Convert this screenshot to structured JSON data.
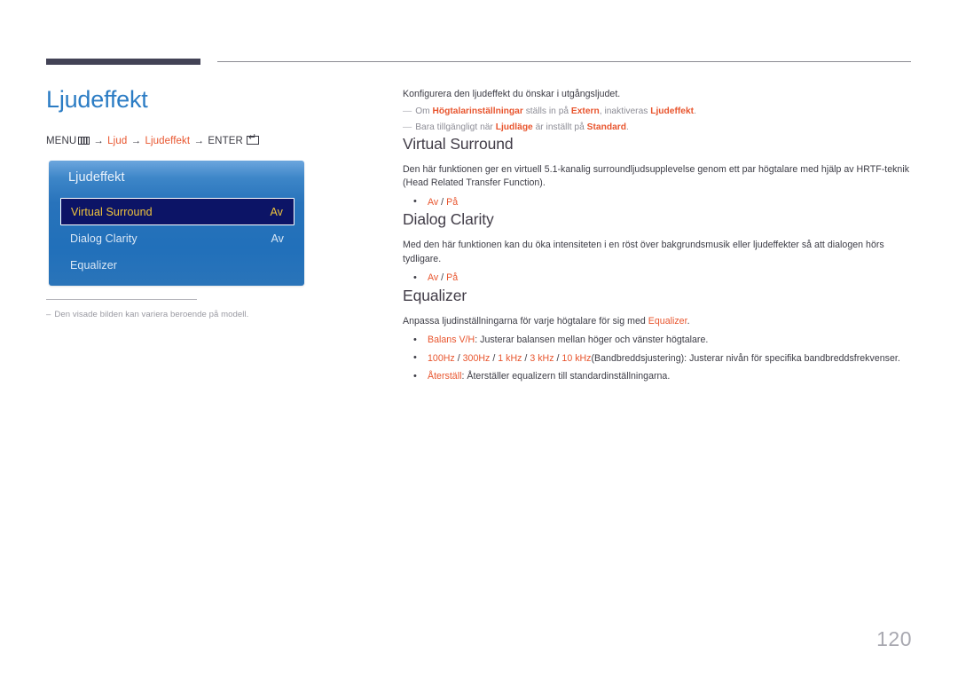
{
  "page": {
    "title": "Ljudeffekt",
    "number": "120"
  },
  "menu_path": {
    "prefix": "MENU",
    "menu_icon": "menu-grid-icon",
    "arrow": "→",
    "step1": "Ljud",
    "step2": "Ljudeffekt",
    "enter": "ENTER",
    "enter_icon": "enter-return-icon"
  },
  "osd": {
    "title": "Ljudeffekt",
    "rows": [
      {
        "label": "Virtual Surround",
        "value": "Av",
        "selected": true
      },
      {
        "label": "Dialog Clarity",
        "value": "Av",
        "selected": false
      },
      {
        "label": "Equalizer",
        "value": "",
        "selected": false
      }
    ]
  },
  "left_footnote": {
    "dash": "–",
    "text": "Den visade bilden kan variera beroende på modell."
  },
  "intro": {
    "paragraph": "Konfigurera den ljudeffekt du önskar i utgångsljudet.",
    "notes": [
      {
        "dash": "—",
        "p1": "Om ",
        "a1": "Högtalarinställningar",
        "p2": " ställs in på ",
        "a2": "Extern",
        "p3": ", inaktiveras ",
        "a3": "Ljudeffekt",
        "p4": "."
      },
      {
        "dash": "—",
        "p1": "Bara tillgängligt när ",
        "a1": "Ljudläge",
        "p2": " är inställt på ",
        "a2": "Standard",
        "p3": ".",
        "a3": "",
        "p4": ""
      }
    ]
  },
  "sections": [
    {
      "heading": "Virtual Surround",
      "paragraph": "Den här funktionen ger en virtuell 5.1-kanalig surroundljudsupplevelse genom ett par högtalare med hjälp av HRTF-teknik (Head Related Transfer Function).",
      "bullet_off": "Av",
      "bullet_sep": " / ",
      "bullet_on": "På"
    },
    {
      "heading": "Dialog Clarity",
      "paragraph": "Med den här funktionen kan du öka intensiteten i en röst över bakgrundsmusik eller ljudeffekter så att dialogen hörs tydligare.",
      "bullet_off": "Av",
      "bullet_sep": " / ",
      "bullet_on": "På"
    }
  ],
  "equalizer": {
    "heading": "Equalizer",
    "lead_pre": "Anpassa ljudinställningarna för varje högtalare för sig med ",
    "lead_accent": "Equalizer",
    "lead_post": ".",
    "bullets": [
      {
        "accent": "Balans V/H",
        "rest": ": Justerar balansen mellan höger och vänster högtalare."
      },
      {
        "freqs": [
          "100Hz",
          "300Hz",
          "1 kHz",
          "3 kHz",
          "10 kHz"
        ],
        "sep": " / ",
        "rest": "(Bandbreddsjustering): Justerar nivån för specifika bandbreddsfrekvenser."
      },
      {
        "accent": "Återställ",
        "rest": ": Återställer equalizern till standardinställningarna."
      }
    ]
  },
  "colors": {
    "title_blue": "#2b7cc4",
    "accent_orange": "#e8552e",
    "heading_dark": "#413c47",
    "osd_selected_bg": "#0c1466",
    "osd_selected_text": "#f0c53c",
    "rule_dark": "#434356"
  }
}
